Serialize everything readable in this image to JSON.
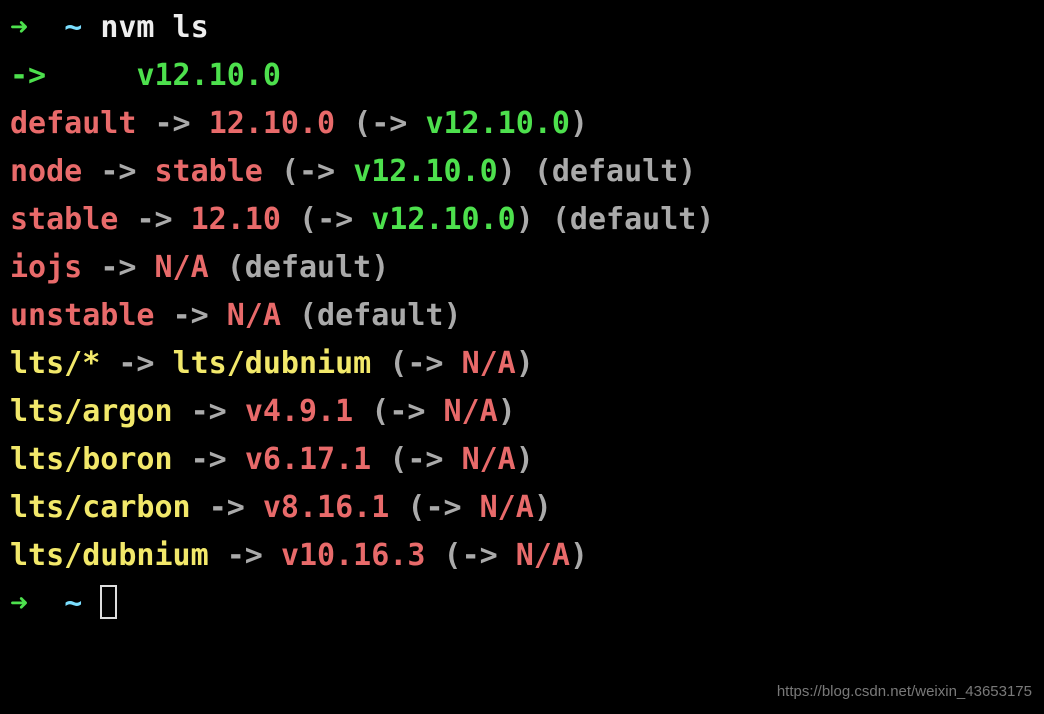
{
  "prompt": {
    "arrow": "➜",
    "tilde": "~"
  },
  "cmd": {
    "nvm_ls": "nvm ls"
  },
  "current": {
    "marker": "->",
    "pad": "     ",
    "version": "v12.10.0"
  },
  "alias": {
    "default": {
      "name": "default",
      "arrow": "->",
      "target": "12.10.0",
      "paren_arrow": "->",
      "resolved": "v12.10.0"
    },
    "node": {
      "name": "node",
      "arrow": "->",
      "target": "stable",
      "paren_arrow": "->",
      "resolved": "v12.10.0",
      "note": "(default)"
    },
    "stable": {
      "name": "stable",
      "arrow": "->",
      "target": "12.10",
      "paren_arrow": "->",
      "resolved": "v12.10.0",
      "note": "(default)"
    },
    "iojs": {
      "name": "iojs",
      "arrow": "->",
      "target": "N/A",
      "note": "(default)"
    },
    "unstable": {
      "name": "unstable",
      "arrow": "->",
      "target": "N/A",
      "note": "(default)"
    }
  },
  "lts": {
    "star": {
      "name": "lts/*",
      "arrow": "->",
      "target": "lts/dubnium",
      "paren_arrow": "->",
      "resolved": "N/A"
    },
    "argon": {
      "name": "lts/argon",
      "arrow": "->",
      "target": "v4.9.1",
      "paren_arrow": "->",
      "resolved": "N/A"
    },
    "boron": {
      "name": "lts/boron",
      "arrow": "->",
      "target": "v6.17.1",
      "paren_arrow": "->",
      "resolved": "N/A"
    },
    "carbon": {
      "name": "lts/carbon",
      "arrow": "->",
      "target": "v8.16.1",
      "paren_arrow": "->",
      "resolved": "N/A"
    },
    "dubnium": {
      "name": "lts/dubnium",
      "arrow": "->",
      "target": "v10.16.3",
      "paren_arrow": "->",
      "resolved": "N/A"
    }
  },
  "paren": {
    "open": "(",
    "close": ")"
  },
  "watermark": "https://blog.csdn.net/weixin_43653175"
}
